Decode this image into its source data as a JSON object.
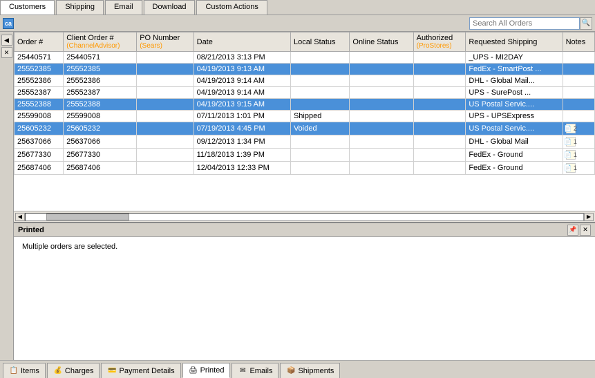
{
  "top_tabs": [
    "Customers",
    "Shipping",
    "Email",
    "Download",
    "Custom Actions"
  ],
  "header": {
    "icon_text": "ca",
    "search_placeholder": "Search All Orders"
  },
  "table": {
    "columns": [
      {
        "label": "Order #",
        "sub": ""
      },
      {
        "label": "Client Order #",
        "sub": "(ChannelAdvisor)"
      },
      {
        "label": "PO Number",
        "sub": "(Sears)"
      },
      {
        "label": "Date",
        "sub": ""
      },
      {
        "label": "Local Status",
        "sub": ""
      },
      {
        "label": "Online Status",
        "sub": ""
      },
      {
        "label": "Authorized",
        "sub": "(ProStores)"
      },
      {
        "label": "Requested Shipping",
        "sub": ""
      },
      {
        "label": "Notes",
        "sub": ""
      }
    ],
    "rows": [
      {
        "order": "25440571",
        "client_order": "25440571",
        "po": "",
        "date": "08/21/2013 3:13 PM",
        "local_status": "",
        "online_status": "",
        "authorized": "",
        "shipping": "_UPS - MI2DAY",
        "notes": "",
        "highlight": false
      },
      {
        "order": "25552385",
        "client_order": "25552385",
        "po": "",
        "date": "04/19/2013 9:13 AM",
        "local_status": "",
        "online_status": "",
        "authorized": "",
        "shipping": "FedEx - SmartPost ...",
        "notes": "",
        "highlight": true
      },
      {
        "order": "25552386",
        "client_order": "25552386",
        "po": "",
        "date": "04/19/2013 9:14 AM",
        "local_status": "",
        "online_status": "",
        "authorized": "",
        "shipping": "DHL - Global Mail...",
        "notes": "",
        "highlight": false
      },
      {
        "order": "25552387",
        "client_order": "25552387",
        "po": "",
        "date": "04/19/2013 9:14 AM",
        "local_status": "",
        "online_status": "",
        "authorized": "",
        "shipping": "UPS - SurePost ...",
        "notes": "",
        "highlight": false
      },
      {
        "order": "25552388",
        "client_order": "25552388",
        "po": "",
        "date": "04/19/2013 9:15 AM",
        "local_status": "",
        "online_status": "",
        "authorized": "",
        "shipping": "US Postal Servic....",
        "notes": "",
        "highlight": true
      },
      {
        "order": "25599008",
        "client_order": "25599008",
        "po": "",
        "date": "07/11/2013 1:01 PM",
        "local_status": "Shipped",
        "online_status": "",
        "authorized": "",
        "shipping": "UPS - UPSExpress",
        "notes": "",
        "highlight": false
      },
      {
        "order": "25605232",
        "client_order": "25605232",
        "po": "",
        "date": "07/19/2013 4:45 PM",
        "local_status": "Voided",
        "online_status": "",
        "authorized": "",
        "shipping": "US Postal Servic....",
        "notes": "2",
        "highlight": true
      },
      {
        "order": "25637066",
        "client_order": "25637066",
        "po": "",
        "date": "09/12/2013 1:34 PM",
        "local_status": "",
        "online_status": "",
        "authorized": "",
        "shipping": "DHL - Global Mail",
        "notes": "1",
        "highlight": false
      },
      {
        "order": "25677330",
        "client_order": "25677330",
        "po": "",
        "date": "11/18/2013 1:39 PM",
        "local_status": "",
        "online_status": "",
        "authorized": "",
        "shipping": "FedEx - Ground",
        "notes": "1",
        "highlight": false
      },
      {
        "order": "25687406",
        "client_order": "25687406",
        "po": "",
        "date": "12/04/2013 12:33 PM",
        "local_status": "",
        "online_status": "",
        "authorized": "",
        "shipping": "FedEx - Ground",
        "notes": "1",
        "highlight": false
      }
    ]
  },
  "bottom_panel": {
    "title": "Printed",
    "message": "Multiple orders are selected.",
    "pin_tooltip": "Pin",
    "close_tooltip": "Close"
  },
  "bottom_tabs": [
    {
      "label": "Items",
      "icon": "📋",
      "active": false
    },
    {
      "label": "Charges",
      "icon": "💰",
      "active": false
    },
    {
      "label": "Payment Details",
      "icon": "💳",
      "active": false
    },
    {
      "label": "Printed",
      "icon": "🖨",
      "active": true
    },
    {
      "label": "Emails",
      "icon": "✉",
      "active": false
    },
    {
      "label": "Shipments",
      "icon": "📦",
      "active": false
    }
  ]
}
